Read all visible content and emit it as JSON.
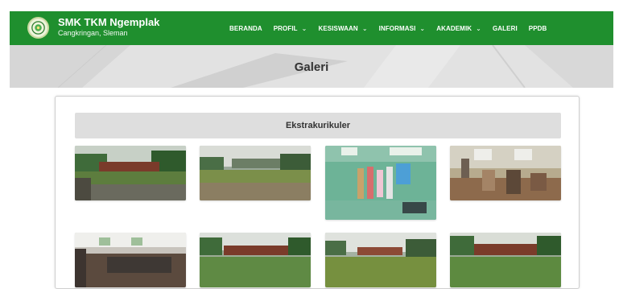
{
  "brand": {
    "title": "SMK TKM Ngemplak",
    "subtitle": "Cangkringan, Sleman"
  },
  "nav": {
    "items": [
      {
        "label": "BERANDA",
        "dropdown": false
      },
      {
        "label": "PROFIL",
        "dropdown": true
      },
      {
        "label": "KESISWAAN",
        "dropdown": true
      },
      {
        "label": "INFORMASI",
        "dropdown": true
      },
      {
        "label": "AKADEMIK",
        "dropdown": true
      },
      {
        "label": "GALERI",
        "dropdown": false
      },
      {
        "label": "PPDB",
        "dropdown": false
      }
    ]
  },
  "banner": {
    "title": "Galeri"
  },
  "gallery": {
    "section_title": "Ekstrakurikuler"
  },
  "colors": {
    "navbar": "#1f8f2e",
    "banner": "#e0e0e0",
    "section_header": "#dedede"
  }
}
